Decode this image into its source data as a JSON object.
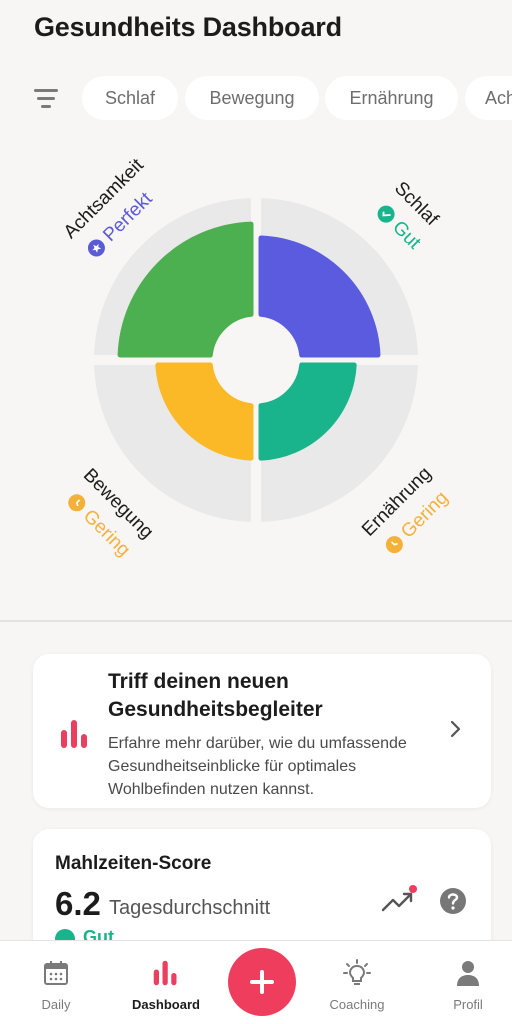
{
  "header": {
    "title": "Gesundheits Dashboard"
  },
  "filters": {
    "icon": "filter-icon",
    "chips": [
      {
        "label": "Schlaf"
      },
      {
        "label": "Bewegung"
      },
      {
        "label": "Ernährung"
      },
      {
        "label": "Ach"
      }
    ]
  },
  "wheel": {
    "segments": [
      {
        "name": "Achtsamkeit",
        "status": "Perfekt",
        "status_icon": "star-badge-icon",
        "color": "#4caf50",
        "text_color": "#5b5bd6",
        "level": 1.0
      },
      {
        "name": "Schlaf",
        "status": "Gut",
        "status_icon": "check-badge-icon",
        "color": "#5b5be0",
        "text_color": "#18b48b",
        "level": 0.76
      },
      {
        "name": "Bewegung",
        "status": "Gering",
        "status_icon": "clock-badge-icon",
        "color": "#fbb927",
        "text_color": "#f4b13a",
        "level": 0.35
      },
      {
        "name": "Ernährung",
        "status": "Gering",
        "status_icon": "clock-badge-icon",
        "color": "#1ab48c",
        "text_color": "#f4b13a",
        "level": 0.35
      }
    ],
    "track_color": "#e9e9e9"
  },
  "promo": {
    "title": "Triff deinen neuen Gesundheitsbegleiter",
    "text": "Erfahre mehr darüber, wie du umfassende Gesundheitseinblicke für optimales Wohlbefinden nutzen kannst.",
    "icon": "bar-chart-icon",
    "accent": "#e8405e"
  },
  "meal": {
    "title": "Mahlzeiten-Score",
    "score": "6.2",
    "subtitle": "Tagesdurchschnitt",
    "status": "Gut"
  },
  "nav": {
    "items": [
      {
        "label": "Daily",
        "icon": "calendar-icon"
      },
      {
        "label": "Dashboard",
        "icon": "bar-chart-icon",
        "active": true
      },
      {
        "label": "Coaching",
        "icon": "lightbulb-icon"
      },
      {
        "label": "Profil",
        "icon": "person-icon"
      }
    ],
    "add_color": "#ef3e5d"
  }
}
